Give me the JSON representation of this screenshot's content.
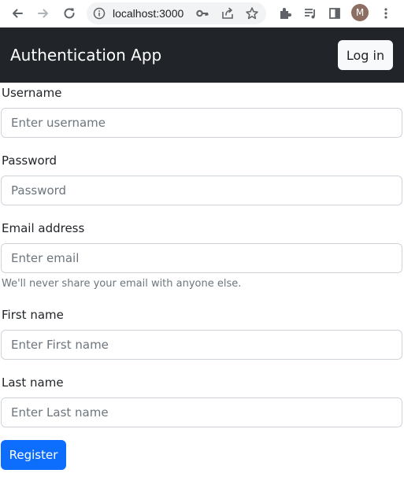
{
  "browser": {
    "url": "localhost:3000",
    "profile_initial": "M",
    "icons": [
      "back-arrow-icon",
      "forward-arrow-icon",
      "reload-icon",
      "site-info-icon",
      "key-icon",
      "share-icon",
      "star-icon",
      "extensions-icon",
      "media-icon",
      "side-panel-icon",
      "kebab-menu-icon"
    ]
  },
  "navbar": {
    "brand": "Authentication App",
    "login_label": "Log in",
    "background": "#212529"
  },
  "form": {
    "username": {
      "label": "Username",
      "placeholder": "Enter username",
      "value": ""
    },
    "password": {
      "label": "Password",
      "placeholder": "Password",
      "value": ""
    },
    "email": {
      "label": "Email address",
      "placeholder": "Enter email",
      "value": "",
      "help": "We'll never share your email with anyone else."
    },
    "first_name": {
      "label": "First name",
      "placeholder": "Enter First name",
      "value": ""
    },
    "last_name": {
      "label": "Last name",
      "placeholder": "Enter Last name",
      "value": ""
    },
    "register_label": "Register",
    "accent": "#0d6efd"
  }
}
